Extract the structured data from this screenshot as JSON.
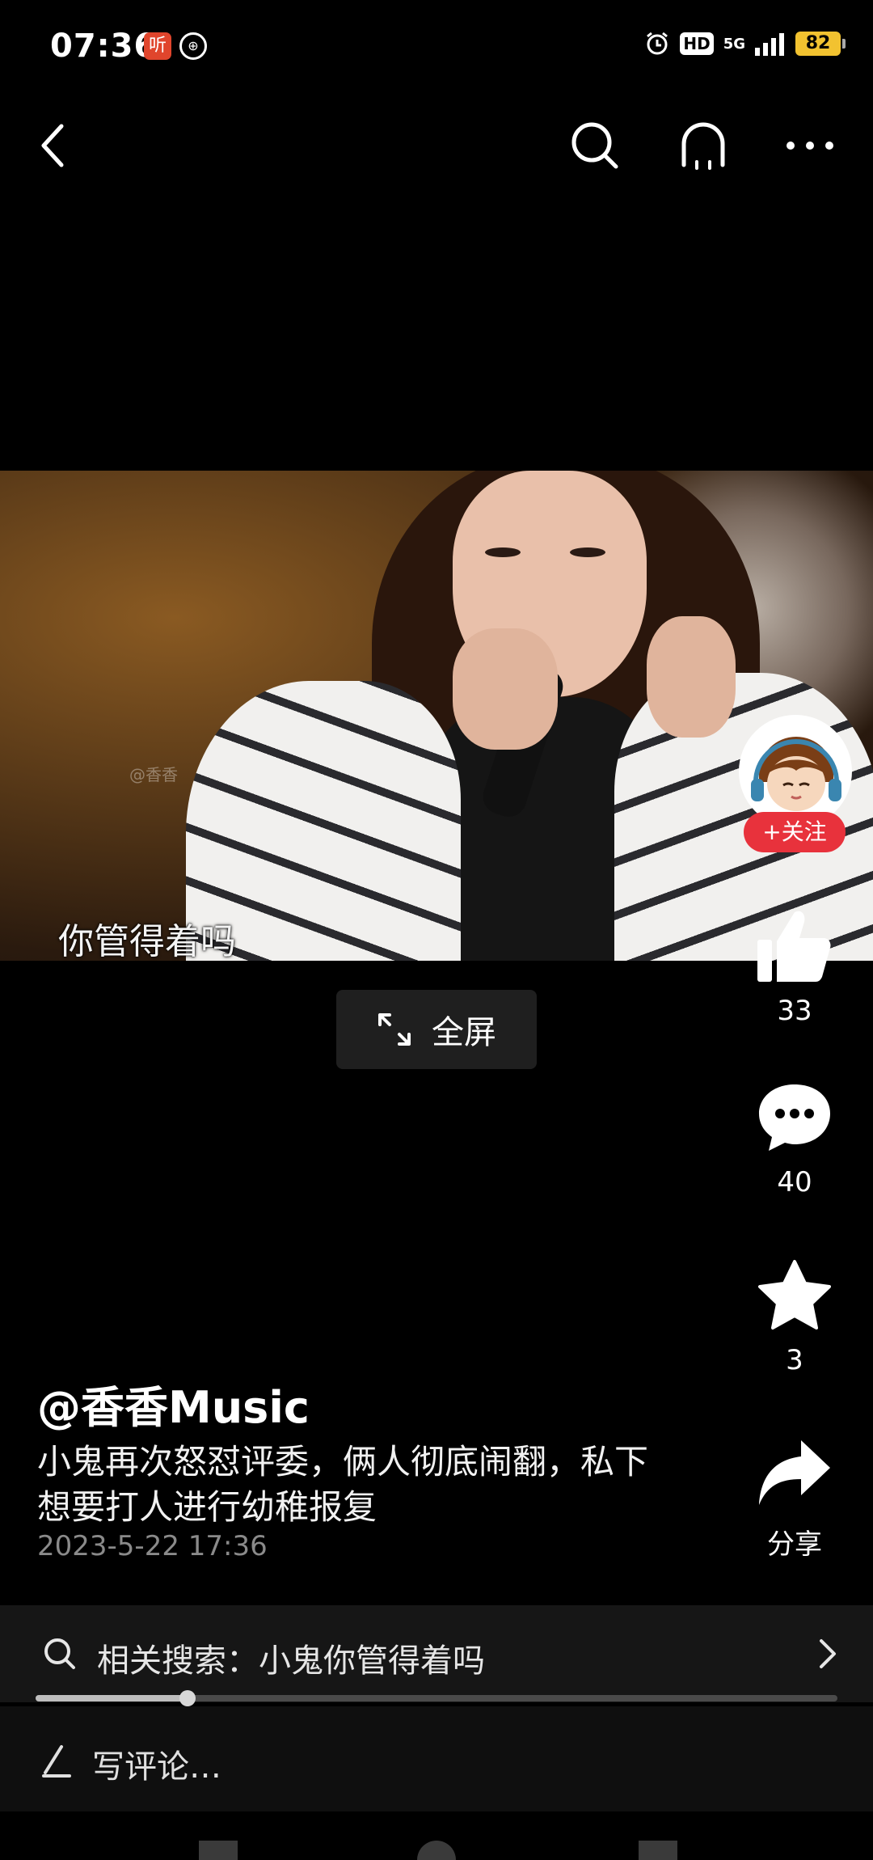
{
  "status_bar": {
    "time": "07:36",
    "app_badge_1": "听",
    "network": "5G",
    "hd": "HD",
    "battery": "82"
  },
  "video": {
    "subtitle": "你管得着吗",
    "watermark": "@香香"
  },
  "fullscreen": {
    "label": "全屏"
  },
  "actions": {
    "follow_label": "+关注",
    "like_count": "33",
    "comment_count": "40",
    "favorite_count": "3",
    "share_label": "分享"
  },
  "post": {
    "author": "@香香Music",
    "description": "小鬼再次怒怼评委，俩人彻底闹翻，私下想要打人进行幼稚报复",
    "date": "2023-5-22 17:36"
  },
  "related_search": {
    "label": "相关搜索：小鬼你管得着吗"
  },
  "playback": {
    "progress_fraction": 0.19
  },
  "comment": {
    "placeholder": "写评论…"
  },
  "colors": {
    "follow_red": "#e8323c",
    "battery_yellow": "#f2c230"
  },
  "icons": [
    "back-icon",
    "search-icon",
    "headphone-icon",
    "more-icon",
    "expand-icon",
    "thumbs-up-icon",
    "comment-icon",
    "star-icon",
    "share-icon",
    "pen-icon",
    "chevron-right-icon"
  ]
}
